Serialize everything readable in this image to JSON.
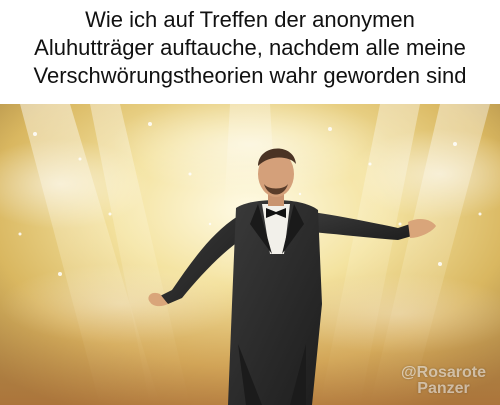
{
  "caption": {
    "line1": "Wie ich auf Treffen der anonymen",
    "line2": "Aluhutträger auftauche, nachdem alle meine",
    "line3": "Verschwörungstheorien wahr geworden sind"
  },
  "watermark": {
    "line1": "@Rosarote",
    "line2": "Panzer"
  },
  "image": {
    "description_icon": "man-in-tuxedo-arms-spread-icon",
    "colors": {
      "glow": "#fff6c8",
      "gold": "#e8c45a",
      "amber": "#c98a2a",
      "haze": "#d9d2c0",
      "suit": "#2b2b2b"
    }
  }
}
